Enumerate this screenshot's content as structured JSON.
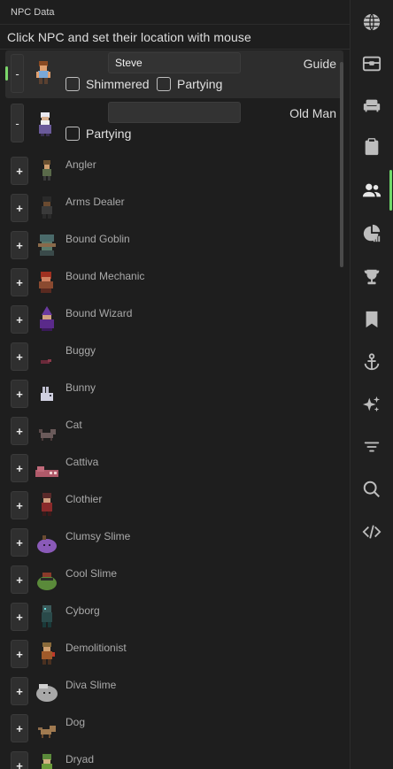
{
  "panel": {
    "title": "NPC Data",
    "instructions": "Click NPC and set their location with mouse"
  },
  "active_npcs": [
    {
      "type": "Guide",
      "name_value": "Steve",
      "selected": true,
      "remove_label": "-",
      "checkboxes": [
        {
          "label": "Shimmered",
          "checked": false
        },
        {
          "label": "Partying",
          "checked": false
        }
      ]
    },
    {
      "type": "Old Man",
      "name_value": "",
      "selected": false,
      "remove_label": "-",
      "checkboxes": [
        {
          "label": "Partying",
          "checked": false
        }
      ]
    }
  ],
  "available_npcs": {
    "add_label": "+",
    "items": [
      "Angler",
      "Arms Dealer",
      "Bound Goblin",
      "Bound Mechanic",
      "Bound Wizard",
      "Buggy",
      "Bunny",
      "Cat",
      "Cattiva",
      "Clothier",
      "Clumsy Slime",
      "Cool Slime",
      "Cyborg",
      "Demolitionist",
      "Diva Slime",
      "Dog",
      "Dryad"
    ]
  },
  "sidebar": {
    "accent": "#6fd96a",
    "active_index": 4,
    "items": [
      "globe-icon",
      "chest-icon",
      "sofa-icon",
      "clipboard-icon",
      "people-icon",
      "pie-chart-icon",
      "trophy-icon",
      "bookmark-icon",
      "anchor-icon",
      "sparkle-icon",
      "filter-icon",
      "search-icon",
      "code-icon"
    ]
  }
}
